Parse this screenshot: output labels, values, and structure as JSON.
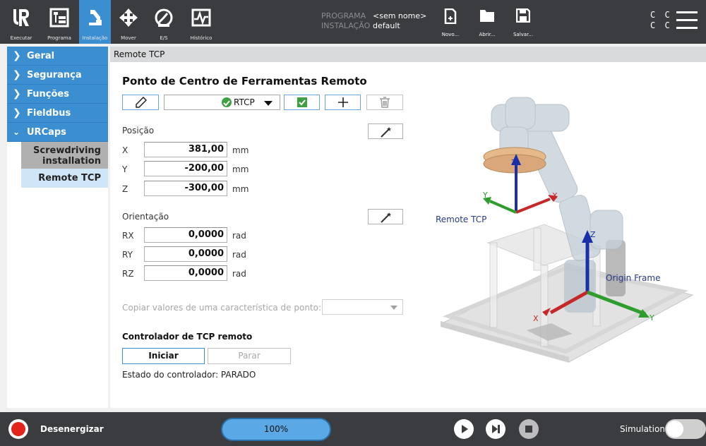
{
  "topbar": {
    "nav": [
      {
        "label": "Executar",
        "icon": "ur-logo-icon"
      },
      {
        "label": "Programa",
        "icon": "program-tree-icon"
      },
      {
        "label": "Instalação",
        "icon": "installation-robot-icon"
      },
      {
        "label": "Mover",
        "icon": "move-arrows-icon"
      },
      {
        "label": "E/S",
        "icon": "io-gauge-icon"
      },
      {
        "label": "Histórico",
        "icon": "log-chart-icon"
      }
    ],
    "program_key": "PROGRAMA",
    "program_value": "<sem nome>",
    "installation_key": "INSTALAÇÃO",
    "installation_value": "default",
    "file_buttons": [
      {
        "label": "Novo...",
        "icon": "new-file-icon"
      },
      {
        "label": "Abrir...",
        "icon": "open-folder-icon"
      },
      {
        "label": "Salvar...",
        "icon": "save-disk-icon"
      }
    ],
    "cc_line1": "C C",
    "cc_line2": "C C",
    "accent": "#3b8fd1"
  },
  "sidebar": {
    "categories": [
      "Geral",
      "Segurança",
      "Funções",
      "Fieldbus",
      "URCaps"
    ],
    "urcaps_items": [
      "Screwdriving installation",
      "Remote TCP"
    ],
    "selected": "Remote TCP"
  },
  "content": {
    "breadcrumb": "Remote TCP",
    "title": "Ponto de Centro de Ferramentas Remoto",
    "tcp_selector": "RTCP",
    "position_label": "Posição",
    "position": [
      {
        "axis": "X",
        "value": "381,00",
        "unit": "mm"
      },
      {
        "axis": "Y",
        "value": "-200,00",
        "unit": "mm"
      },
      {
        "axis": "Z",
        "value": "-300,00",
        "unit": "mm"
      }
    ],
    "orientation_label": "Orientação",
    "orientation": [
      {
        "axis": "RX",
        "value": "0,0000",
        "unit": "rad"
      },
      {
        "axis": "RY",
        "value": "0,0000",
        "unit": "rad"
      },
      {
        "axis": "RZ",
        "value": "0,0000",
        "unit": "rad"
      }
    ],
    "copy_label": "Copiar valores de uma característica de ponto:",
    "controller_title": "Controlador de TCP remoto",
    "start_label": "Iniciar",
    "stop_label": "Parar",
    "controller_state": "Estado do controlador: PARADO",
    "scene": {
      "remote_tcp_label": "Remote TCP",
      "origin_frame_label": "Origin Frame",
      "axis_x": "X",
      "axis_y": "Y",
      "axis_z": "Z",
      "colors": {
        "x": "#c62828",
        "y": "#2e9d2e",
        "z": "#1a2fa8"
      }
    }
  },
  "bottombar": {
    "power_label": "Desenergizar",
    "speed": "100%",
    "simulation_label": "Simulation"
  }
}
